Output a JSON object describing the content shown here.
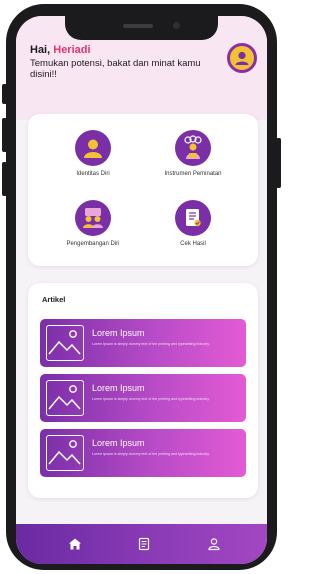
{
  "header": {
    "greeting_prefix": "Hai,",
    "user_name": "Heriadi",
    "subtitle": "Temukan potensi, bakat dan minat kamu disini!!"
  },
  "menu": [
    {
      "label": "Identitas Diri",
      "icon": "user-icon"
    },
    {
      "label": "Instrumen Peminatan",
      "icon": "survey-group-icon"
    },
    {
      "label": "Pengembangan Diri",
      "icon": "people-development-icon"
    },
    {
      "label": "Cek Hasil",
      "icon": "document-check-icon"
    }
  ],
  "articles": {
    "section_title": "Artikel",
    "items": [
      {
        "title": "Lorem Ipsum",
        "excerpt": "Lorem Ipsum is simply dummy text of the printing and typesetting industry."
      },
      {
        "title": "Lorem Ipsum",
        "excerpt": "Lorem Ipsum is simply dummy text of the printing and typesetting industry."
      },
      {
        "title": "Lorem Ipsum",
        "excerpt": "Lorem Ipsum is simply dummy text of the printing and typesetting industry."
      }
    ]
  },
  "bottom_nav": [
    {
      "icon": "home-icon"
    },
    {
      "icon": "document-icon"
    },
    {
      "icon": "profile-icon"
    }
  ],
  "colors": {
    "primary_purple": "#7b2fa6",
    "accent_pink": "#e5336b",
    "header_bg": "#f9e6f3",
    "avatar_yellow": "#f1c233"
  }
}
